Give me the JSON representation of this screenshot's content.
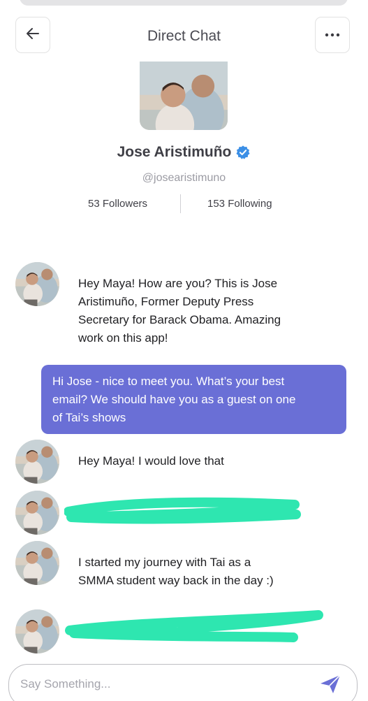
{
  "header": {
    "title": "Direct Chat",
    "back_icon": "arrow-left-icon",
    "more_icon": "more-horizontal-icon"
  },
  "profile": {
    "name": "Jose Aristimuño",
    "handle": "@josearistimuno",
    "verified": true,
    "followers": "53 Followers",
    "following": "153 Following"
  },
  "messages": [
    {
      "direction": "incoming",
      "text": "Hey Maya! How are you? This is Jose\nAristimuño, Former Deputy Press\nSecretary for Barack Obama. Amazing\nwork on this app!"
    },
    {
      "direction": "outgoing",
      "text": "Hi Jose - nice to meet you. What’s your best\nemail? We should have you as a guest on one\nof Tai’s shows"
    },
    {
      "direction": "incoming",
      "text": "Hey Maya! I would love that"
    },
    {
      "direction": "incoming",
      "text": "",
      "redacted": true
    },
    {
      "direction": "incoming",
      "text": "I started my journey with Tai as a\nSMMA student way back in the day :)"
    },
    {
      "direction": "incoming",
      "text": "",
      "redacted": true
    }
  ],
  "composer": {
    "placeholder": "Say Something...",
    "value": "",
    "send_icon": "send-icon"
  },
  "colors": {
    "outgoing_bubble": "#6a6fd6",
    "verified_badge": "#3b8fe6",
    "send_icon": "#6a6fd6",
    "redaction_marker": "#2ee6b0"
  }
}
